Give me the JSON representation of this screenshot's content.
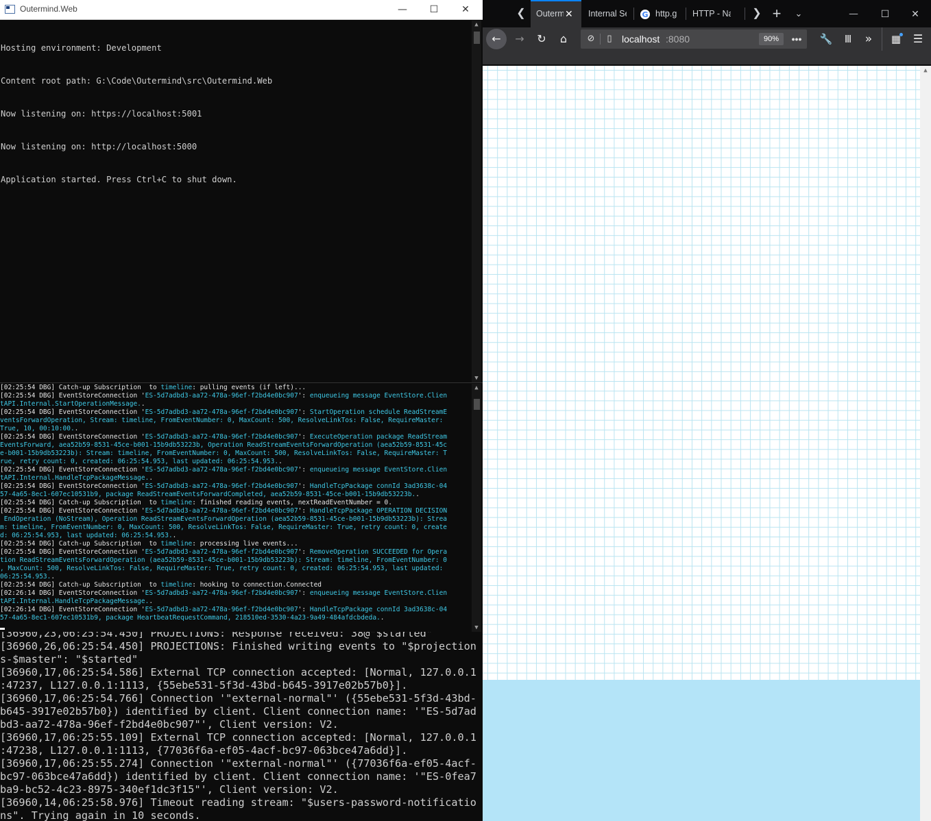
{
  "console": {
    "title": "Outermind.Web",
    "lines": [
      "Hosting environment: Development",
      "Content root path: G:\\Code\\Outermind\\src\\Outermind.Web",
      "Now listening on: https://localhost:5001",
      "Now listening on: http://localhost:5000",
      "Application started. Press Ctrl+C to shut down."
    ]
  },
  "window_controls": {
    "minimize": "—",
    "maximize": "☐",
    "close": "✕"
  },
  "logs": [
    [
      {
        "t": "[02:25:54 DBG] Catch-up Subscription  to "
      },
      {
        "t": "timeline",
        "c": 1
      },
      {
        "t": ": pulling events (if left)..."
      }
    ],
    [
      {
        "t": "[02:25:54 DBG] EventStoreConnection '"
      },
      {
        "t": "ES-5d7adbd3-aa72-478a-96ef-f2bd4e0bc907",
        "c": 1
      },
      {
        "t": "': "
      },
      {
        "t": "enqueueing message EventStore.Clien",
        "c": 1
      }
    ],
    [
      {
        "t": "tAPI.Internal.StartOperationMessage.",
        "c": 1
      },
      {
        "t": "."
      }
    ],
    [
      {
        "t": "[02:25:54 DBG] EventStoreConnection '"
      },
      {
        "t": "ES-5d7adbd3-aa72-478a-96ef-f2bd4e0bc907",
        "c": 1
      },
      {
        "t": "': "
      },
      {
        "t": "StartOperation schedule ReadStreamE",
        "c": 1
      }
    ],
    [
      {
        "t": "ventsForwardOperation, Stream: timeline, FromEventNumber: 0, MaxCount: 500, ResolveLinkTos: False, RequireMaster:",
        "c": 1
      }
    ],
    [
      {
        "t": "True, 10, 00:10:00.",
        "c": 1
      },
      {
        "t": "."
      }
    ],
    [
      {
        "t": "[02:25:54 DBG] EventStoreConnection '"
      },
      {
        "t": "ES-5d7adbd3-aa72-478a-96ef-f2bd4e0bc907",
        "c": 1
      },
      {
        "t": "': "
      },
      {
        "t": "ExecuteOperation package ReadStream",
        "c": 1
      }
    ],
    [
      {
        "t": "EventsForward, aea52b59-8531-45ce-b001-15b9db53223b, Operation ReadStreamEventsForwardOperation (aea52b59-8531-45c",
        "c": 1
      }
    ],
    [
      {
        "t": "e-b001-15b9db53223b): Stream: timeline, FromEventNumber: 0, MaxCount: 500, ResolveLinkTos: False, RequireMaster: T",
        "c": 1
      }
    ],
    [
      {
        "t": "rue, retry count: 0, created: 06:25:54.953, last updated: 06:25:54.953.",
        "c": 1
      },
      {
        "t": "."
      }
    ],
    [
      {
        "t": "[02:25:54 DBG] EventStoreConnection '"
      },
      {
        "t": "ES-5d7adbd3-aa72-478a-96ef-f2bd4e0bc907",
        "c": 1
      },
      {
        "t": "': "
      },
      {
        "t": "enqueueing message EventStore.Clien",
        "c": 1
      }
    ],
    [
      {
        "t": "tAPI.Internal.HandleTcpPackageMessage.",
        "c": 1
      },
      {
        "t": "."
      }
    ],
    [
      {
        "t": "[02:25:54 DBG] EventStoreConnection '"
      },
      {
        "t": "ES-5d7adbd3-aa72-478a-96ef-f2bd4e0bc907",
        "c": 1
      },
      {
        "t": "': "
      },
      {
        "t": "HandleTcpPackage connId 3ad3638c-04",
        "c": 1
      }
    ],
    [
      {
        "t": "57-4a65-8ec1-607ec10531b9, package ReadStreamEventsForwardCompleted, aea52b59-8531-45ce-b001-15b9db53223b.",
        "c": 1
      },
      {
        "t": "."
      }
    ],
    [
      {
        "t": "[02:25:54 DBG] Catch-up Subscription  to "
      },
      {
        "t": "timeline",
        "c": 1
      },
      {
        "t": ": finished reading events, nextReadEventNumber = 0."
      }
    ],
    [
      {
        "t": "[02:25:54 DBG] EventStoreConnection '"
      },
      {
        "t": "ES-5d7adbd3-aa72-478a-96ef-f2bd4e0bc907",
        "c": 1
      },
      {
        "t": "': "
      },
      {
        "t": "HandleTcpPackage OPERATION DECISION",
        "c": 1
      }
    ],
    [
      {
        "t": " EndOperation (NoStream), Operation ReadStreamEventsForwardOperation (aea52b59-8531-45ce-b001-15b9db53223b): Strea",
        "c": 1
      }
    ],
    [
      {
        "t": "m: timeline, FromEventNumber: 0, MaxCount: 500, ResolveLinkTos: False, RequireMaster: True, retry count: 0, create",
        "c": 1
      }
    ],
    [
      {
        "t": "d: 06:25:54.953, last updated: 06:25:54.953.",
        "c": 1
      },
      {
        "t": "."
      }
    ],
    [
      {
        "t": "[02:25:54 DBG] Catch-up Subscription  to "
      },
      {
        "t": "timeline",
        "c": 1
      },
      {
        "t": ": processing live events..."
      }
    ],
    [
      {
        "t": "[02:25:54 DBG] EventStoreConnection '"
      },
      {
        "t": "ES-5d7adbd3-aa72-478a-96ef-f2bd4e0bc907",
        "c": 1
      },
      {
        "t": "': "
      },
      {
        "t": "RemoveOperation SUCCEEDED for Opera",
        "c": 1
      }
    ],
    [
      {
        "t": "tion ReadStreamEventsForwardOperation (aea52b59-8531-45ce-b001-15b9db53223b): Stream: timeline, FromEventNumber: 0",
        "c": 1
      }
    ],
    [
      {
        "t": ", MaxCount: 500, ResolveLinkTos: False, RequireMaster: True, retry count: 0, created: 06:25:54.953, last updated:",
        "c": 1
      }
    ],
    [
      {
        "t": "06:25:54.953.",
        "c": 1
      },
      {
        "t": "."
      }
    ],
    [
      {
        "t": "[02:25:54 DBG] Catch-up Subscription  to "
      },
      {
        "t": "timeline",
        "c": 1
      },
      {
        "t": ": hooking to connection.Connected"
      }
    ],
    [
      {
        "t": "[02:26:14 DBG] EventStoreConnection '"
      },
      {
        "t": "ES-5d7adbd3-aa72-478a-96ef-f2bd4e0bc907",
        "c": 1
      },
      {
        "t": "': "
      },
      {
        "t": "enqueueing message EventStore.Clien",
        "c": 1
      }
    ],
    [
      {
        "t": "tAPI.Internal.HandleTcpPackageMessage.",
        "c": 1
      },
      {
        "t": "."
      }
    ],
    [
      {
        "t": "[02:26:14 DBG] EventStoreConnection '"
      },
      {
        "t": "ES-5d7adbd3-aa72-478a-96ef-f2bd4e0bc907",
        "c": 1
      },
      {
        "t": "': "
      },
      {
        "t": "HandleTcpPackage connId 3ad3638c-04",
        "c": 1
      }
    ],
    [
      {
        "t": "57-4a65-8ec1-607ec10531b9, package HeartbeatRequestCommand, 218510ed-3530-4a23-9a49-484afdcbdeda.",
        "c": 1
      },
      {
        "t": "."
      }
    ]
  ],
  "eventstore": [
    "[36960,23,06:25:54.450] PROJECTIONS: Response received: 38@\"$started\"",
    "[36960,26,06:25:54.450] PROJECTIONS: Finished writing events to \"$projection",
    "s-$master\": \"$started\"",
    "[36960,17,06:25:54.586] External TCP connection accepted: [Normal, 127.0.0.1",
    ":47237, L127.0.0.1:1113, {55ebe531-5f3d-43bd-b645-3917e02b57b0}].",
    "[36960,17,06:25:54.766] Connection '\"external-normal\"' ({55ebe531-5f3d-43bd-",
    "b645-3917e02b57b0}) identified by client. Client connection name: '\"ES-5d7ad",
    "bd3-aa72-478a-96ef-f2bd4e0bc907\"', Client version: V2.",
    "[36960,17,06:25:55.109] External TCP connection accepted: [Normal, 127.0.0.1",
    ":47238, L127.0.0.1:1113, {77036f6a-ef05-4acf-bc97-063bce47a6dd}].",
    "[36960,17,06:25:55.274] Connection '\"external-normal\"' ({77036f6a-ef05-4acf-",
    "bc97-063bce47a6dd}) identified by client. Client connection name: '\"ES-0fea7",
    "ba9-bc52-4c23-8975-340ef1dc3f15\"', Client version: V2.",
    "[36960,14,06:25:58.976] Timeout reading stream: \"$users-password-notificatio",
    "ns\". Trying again in 10 seconds."
  ],
  "browser": {
    "tabs": [
      {
        "label": "Outermind.Web",
        "active": true
      },
      {
        "label": "Internal Se",
        "active": false
      },
      {
        "label": "http.g",
        "active": false,
        "icon": "google-icon"
      },
      {
        "label": "HTTP - Na",
        "active": false
      }
    ],
    "tab_close": "✕",
    "url_host": "localhost",
    "url_port": ":8080",
    "zoom": "90%",
    "icons": [
      "back-arrow-icon",
      "forward-arrow-icon",
      "reload-icon",
      "home-icon",
      "tracking-protection-icon",
      "page-icon",
      "page-actions-icon",
      "wrench-icon",
      "library-icon",
      "overflow-icon",
      "extensions-icon",
      "menu-icon",
      "tab-scroll-left-icon",
      "tab-scroll-right-icon",
      "new-tab-icon",
      "tab-list-icon"
    ],
    "colors": {
      "grid_line": "#b9e4f1",
      "bottom_fill": "#b4e4f8",
      "toolbar": "#323234",
      "accent": "#0a84ff"
    }
  }
}
